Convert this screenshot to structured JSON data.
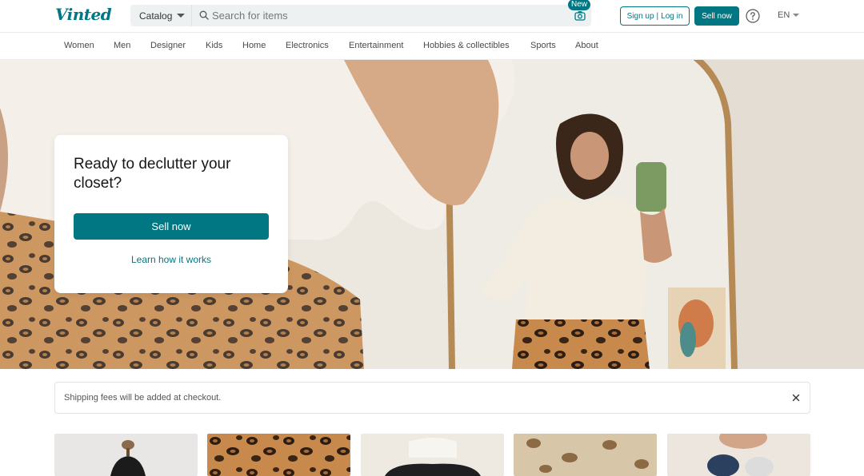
{
  "header": {
    "logo": "Vinted",
    "catalog_label": "Catalog",
    "search_placeholder": "Search for items",
    "new_badge": "New",
    "signup_label": "Sign up",
    "login_label": "Log in",
    "sell_label": "Sell now",
    "lang": "EN"
  },
  "nav": {
    "items": [
      "Women",
      "Men",
      "Designer",
      "Kids",
      "Home",
      "Electronics",
      "Entertainment",
      "Hobbies & collectibles",
      "Sports",
      "About"
    ]
  },
  "hero": {
    "title": "Ready to declutter your closet?",
    "sell_label": "Sell now",
    "learn_label": "Learn how it works"
  },
  "notice": {
    "text": "Shipping fees will be added at checkout."
  },
  "colors": {
    "brand": "#007782"
  }
}
